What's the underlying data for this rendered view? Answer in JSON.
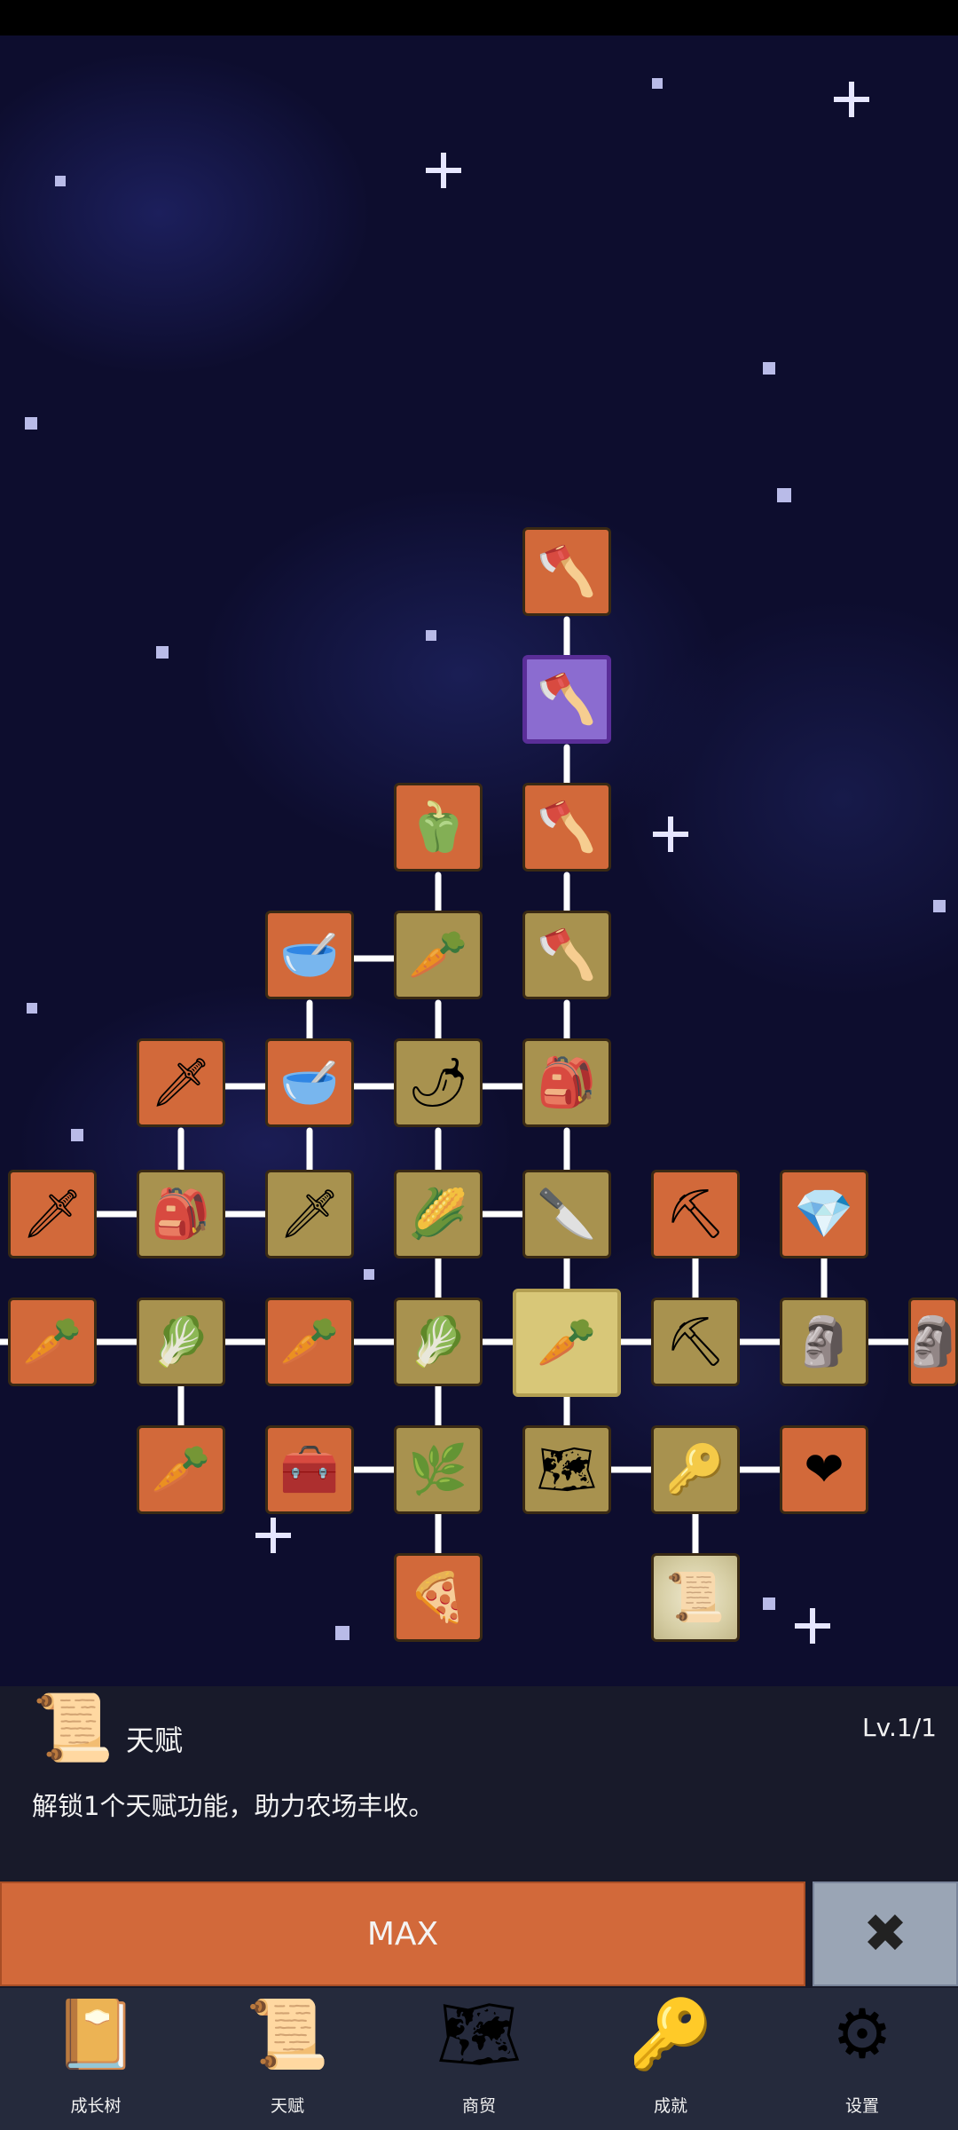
{
  "talent_tree": {
    "nodes": [
      {
        "id": "shovel-a",
        "icon": "🪓",
        "color": "orange",
        "name": "shovel-upgrade-icon"
      },
      {
        "id": "shovel-b",
        "icon": "🪓",
        "color": "purple",
        "name": "shovel-purple-icon"
      },
      {
        "id": "pepper",
        "icon": "🫑",
        "color": "orange",
        "name": "pepper-icon"
      },
      {
        "id": "shovel-c",
        "icon": "🪓",
        "color": "orange",
        "name": "shovel-upgrade-icon"
      },
      {
        "id": "bowl-a",
        "icon": "🥣",
        "color": "orange",
        "name": "soup-bowl-icon"
      },
      {
        "id": "radish",
        "icon": "🥕",
        "color": "khaki",
        "name": "radish-icon"
      },
      {
        "id": "shovel-d",
        "icon": "🪓",
        "color": "khaki",
        "name": "shovel-icon"
      },
      {
        "id": "sword-a",
        "icon": "🗡",
        "color": "orange",
        "name": "sword-icon"
      },
      {
        "id": "bowl-b",
        "icon": "🥣",
        "color": "orange",
        "name": "bowl-icon"
      },
      {
        "id": "chili",
        "icon": "🌶",
        "color": "khaki",
        "name": "chili-icon"
      },
      {
        "id": "backpack-a",
        "icon": "🎒",
        "color": "khaki",
        "name": "backpack-icon"
      },
      {
        "id": "sword-b",
        "icon": "🗡",
        "color": "orange",
        "name": "sword-icon"
      },
      {
        "id": "backpack-b",
        "icon": "🎒",
        "color": "khaki",
        "name": "backpack-icon"
      },
      {
        "id": "sword-c",
        "icon": "🗡",
        "color": "khaki",
        "name": "sword-icon"
      },
      {
        "id": "corn",
        "icon": "🌽",
        "color": "khaki",
        "name": "corn-icon"
      },
      {
        "id": "dagger",
        "icon": "🔪",
        "color": "khaki",
        "name": "dagger-icon"
      },
      {
        "id": "pickaxe-a",
        "icon": "⛏",
        "color": "orange",
        "name": "pickaxe-icon"
      },
      {
        "id": "crystal",
        "icon": "💎",
        "color": "orange",
        "name": "crystal-icon"
      },
      {
        "id": "carrot-a",
        "icon": "🥕",
        "color": "orange",
        "name": "carrot-icon"
      },
      {
        "id": "cabbage-a",
        "icon": "🥬",
        "color": "khaki",
        "name": "cabbage-icon"
      },
      {
        "id": "carrot-b",
        "icon": "🥕",
        "color": "orange",
        "name": "carrot-icon"
      },
      {
        "id": "cabbage-b",
        "icon": "🥬",
        "color": "khaki",
        "name": "cabbage-icon"
      },
      {
        "id": "carrot-center",
        "icon": "🥕",
        "color": "selected",
        "name": "carrot-selected-icon"
      },
      {
        "id": "pickaxe-b",
        "icon": "⛏",
        "color": "khaki",
        "name": "pickaxe-icon"
      },
      {
        "id": "statue-a",
        "icon": "🗿",
        "color": "khaki",
        "name": "statue-icon"
      },
      {
        "id": "statue-b",
        "icon": "🗿",
        "color": "orange",
        "name": "statue-icon"
      },
      {
        "id": "carrot-c",
        "icon": "🥕",
        "color": "orange",
        "name": "carrot-icon"
      },
      {
        "id": "chest",
        "icon": "🧰",
        "color": "orange",
        "name": "treasure-chest-icon"
      },
      {
        "id": "parsnip",
        "icon": "🌿",
        "color": "khaki",
        "name": "parsnip-icon"
      },
      {
        "id": "map",
        "icon": "🗺",
        "color": "khaki",
        "name": "map-icon"
      },
      {
        "id": "key",
        "icon": "🔑",
        "color": "khaki",
        "name": "key-icon"
      },
      {
        "id": "heart",
        "icon": "❤",
        "color": "orange",
        "name": "heart-icon"
      },
      {
        "id": "pizza",
        "icon": "🍕",
        "color": "orange",
        "name": "pizza-icon"
      },
      {
        "id": "scroll",
        "icon": "📜",
        "color": "scroll",
        "name": "scroll-icon"
      }
    ]
  },
  "info": {
    "icon": "📜",
    "title": "天赋",
    "level": "Lv.1/1",
    "description": "解锁1个天赋功能，助力农场丰收。"
  },
  "actions": {
    "max_label": "MAX",
    "close_glyph": "✖"
  },
  "nav": [
    {
      "label": "成长树",
      "icon": "📔"
    },
    {
      "label": "天赋",
      "icon": "📜"
    },
    {
      "label": "商贸",
      "icon": "🗺"
    },
    {
      "label": "成就",
      "icon": "🔑"
    },
    {
      "label": "设置",
      "icon": "⚙"
    }
  ]
}
